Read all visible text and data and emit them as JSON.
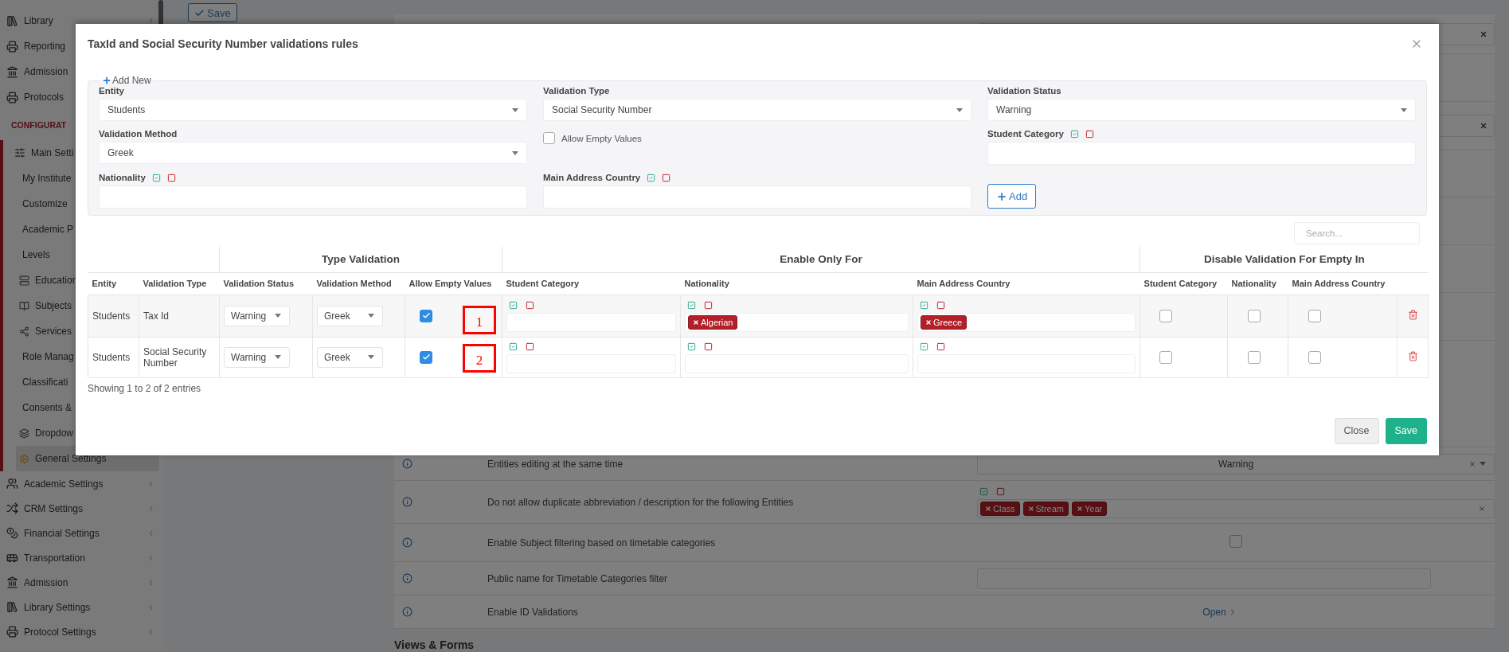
{
  "sidebar": {
    "items": [
      {
        "kind": "item",
        "label": "Library",
        "selected": false
      },
      {
        "kind": "item",
        "label": "Reporting",
        "selected": false
      },
      {
        "kind": "item",
        "label": "Admission",
        "selected": false
      },
      {
        "kind": "item",
        "label": "Protocols",
        "selected": false
      },
      {
        "kind": "heading",
        "label": "CONFIGURAT"
      },
      {
        "kind": "group",
        "label": "Main Setti",
        "expanded": true,
        "selected": false,
        "children": [
          {
            "label": "My Institute",
            "selected": false
          },
          {
            "label": "Customize",
            "selected": false
          },
          {
            "label": "Academic P",
            "selected": false
          },
          {
            "label": "Levels",
            "selected": false
          },
          {
            "label": "Education",
            "selected": false
          },
          {
            "label": "Subjects",
            "selected": false
          },
          {
            "label": "Services",
            "selected": false
          },
          {
            "label": "Role Manag",
            "selected": false
          },
          {
            "label": "Classificati",
            "selected": false
          },
          {
            "label": "Consents &",
            "selected": false
          },
          {
            "label": "Dropdow",
            "selected": false
          },
          {
            "label": "General Settings",
            "selected": true
          }
        ]
      },
      {
        "kind": "item",
        "label": "Academic Settings",
        "selected": false
      },
      {
        "kind": "item",
        "label": "CRM Settings",
        "selected": false
      },
      {
        "kind": "item",
        "label": "Financial Settings",
        "selected": false
      },
      {
        "kind": "item",
        "label": "Transportation",
        "selected": false
      },
      {
        "kind": "item",
        "label": "Admission",
        "selected": false
      },
      {
        "kind": "item",
        "label": "Library Settings",
        "selected": false
      },
      {
        "kind": "item",
        "label": "Protocol Settings",
        "selected": false
      }
    ]
  },
  "page": {
    "save_button": "Save",
    "settings_rows": [
      {
        "kind": "select",
        "label": "Entities editing at the same time",
        "value": "Warning"
      },
      {
        "kind": "tags",
        "label": "Do not allow duplicate abbreviation / description for the following Entities",
        "tags": [
          "Class",
          "Stream",
          "Year"
        ]
      },
      {
        "kind": "checkbox",
        "label": "Enable Subject filtering based on timetable categories",
        "checked": false
      },
      {
        "kind": "input",
        "label": "Public name for Timetable Categories filter"
      },
      {
        "kind": "link",
        "label": "Enable ID Validations",
        "value": "Open"
      }
    ],
    "section_heading": "Views & Forms"
  },
  "modal": {
    "title": "TaxId and Social Security Number validations rules",
    "add_new": {
      "legend": "Add New",
      "fields": [
        {
          "kind": "select",
          "label": "Entity",
          "value": "Students"
        },
        {
          "kind": "select",
          "label": "Validation Type",
          "value": "Social Security Number"
        },
        {
          "kind": "select",
          "label": "Validation Status",
          "value": "Warning"
        },
        {
          "kind": "select",
          "label": "Validation Method",
          "value": "Greek"
        },
        {
          "kind": "checkbox",
          "label": "Allow Empty Values",
          "checked": false
        },
        {
          "kind": "tags",
          "label": "Student Category"
        },
        {
          "kind": "tags",
          "label": "Nationality"
        },
        {
          "kind": "tags",
          "label": "Main Address Country"
        },
        {
          "kind": "button",
          "label": "Add"
        }
      ]
    },
    "search": {
      "placeholder": "Search..."
    },
    "table": {
      "header": {
        "leading_columns": [
          "Entity",
          "Validation Type"
        ],
        "groups": [
          {
            "label": "Type Validation",
            "columns": [
              "Validation Status",
              "Validation Method",
              "Allow Empty Values"
            ]
          },
          {
            "label": "Enable Only For",
            "columns": [
              "Student Category",
              "Nationality",
              "Main Address Country"
            ]
          },
          {
            "label": "Disable Validation For Empty In",
            "columns": [
              "Student Category",
              "Nationality",
              "Main Address Country"
            ]
          }
        ]
      },
      "rows": [
        {
          "entity": "Students",
          "validation_type": "Tax Id",
          "validation_status": "Warning",
          "validation_method": "Greek",
          "allow_empty": true,
          "annotation": "1",
          "nationality": [
            "Algerian"
          ],
          "main_address_country": [
            "Greece"
          ],
          "disable_student_category": false,
          "disable_nationality": false,
          "disable_main_address_country": false
        },
        {
          "entity": "Students",
          "validation_type": "Social Security Number",
          "validation_status": "Warning",
          "validation_method": "Greek",
          "allow_empty": true,
          "annotation": "2",
          "disable_student_category": false,
          "disable_nationality": false,
          "disable_main_address_country": false
        }
      ]
    },
    "info": "Showing 1 to 2 of 2 entries",
    "buttons": [
      {
        "kind": "secondary",
        "label": "Close"
      },
      {
        "kind": "primary",
        "label": "Save"
      }
    ]
  }
}
